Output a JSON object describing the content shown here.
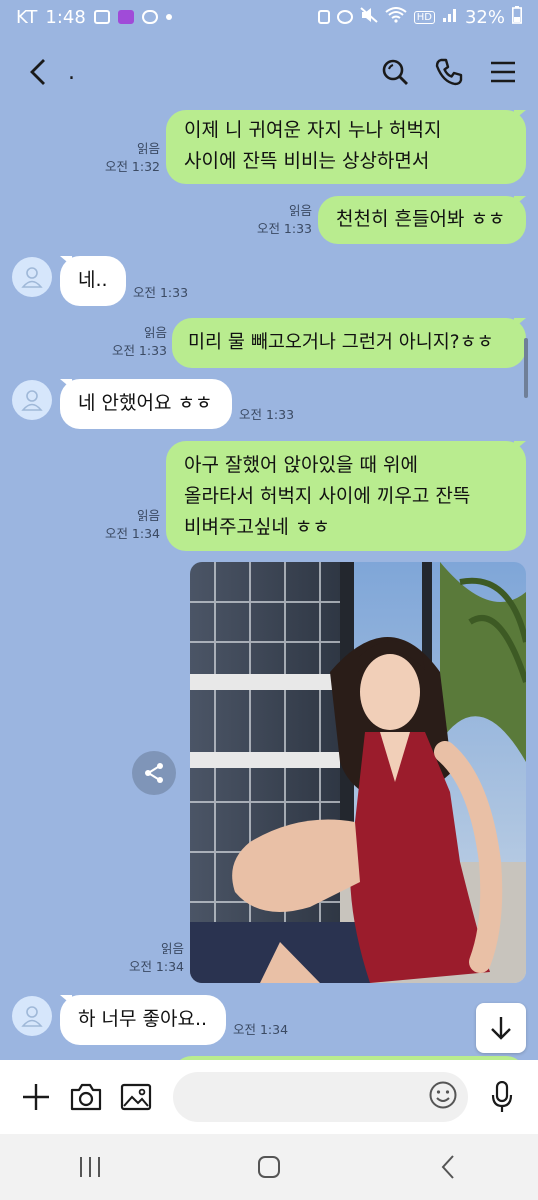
{
  "status_bar": {
    "carrier": "KT",
    "time": "1:48",
    "hd_label": "HD",
    "battery": "32%"
  },
  "header": {
    "title": "."
  },
  "messages": [
    {
      "dir": "out",
      "text": "이제 니 귀여운 자지 누나 허벅지\n사이에 잔뜩 비비는 상상하면서",
      "read": "읽음",
      "time": "오전 1:32"
    },
    {
      "dir": "out",
      "text": "천천히 흔들어봐 ㅎㅎ",
      "read": "읽음",
      "time": "오전 1:33"
    },
    {
      "dir": "in",
      "text": "네..",
      "time": "오전 1:33"
    },
    {
      "dir": "out",
      "text": "미리 물 빼고오거나 그런거 아니지?ㅎㅎ",
      "read": "읽음",
      "time": "오전 1:33"
    },
    {
      "dir": "in",
      "text": "네 안했어요 ㅎㅎ",
      "time": "오전 1:33"
    },
    {
      "dir": "out",
      "text": "아구 잘했어 앉아있을 때 위에\n올라타서 허벅지 사이에 끼우고 잔뜩\n비벼주고싶네 ㅎㅎ",
      "read": "읽음",
      "time": "오전 1:34"
    },
    {
      "dir": "out",
      "type": "photo",
      "read": "읽음",
      "time": "오전 1:34"
    },
    {
      "dir": "in",
      "text": "하 너무 좋아요..",
      "time": "오전 1:34"
    }
  ],
  "colors": {
    "background": "#9bb5e0",
    "outgoing_bubble": "#b9ec8f",
    "incoming_bubble": "#ffffff"
  },
  "icons": {
    "back": "chevron-left-icon",
    "search": "search-icon",
    "call": "phone-icon",
    "menu": "menu-icon",
    "share": "share-icon",
    "scroll_down": "arrow-down-icon",
    "add": "plus-icon",
    "camera": "camera-icon",
    "gallery": "image-icon",
    "emoji": "emoji-icon",
    "mic": "microphone-icon"
  },
  "input": {
    "placeholder": ""
  }
}
